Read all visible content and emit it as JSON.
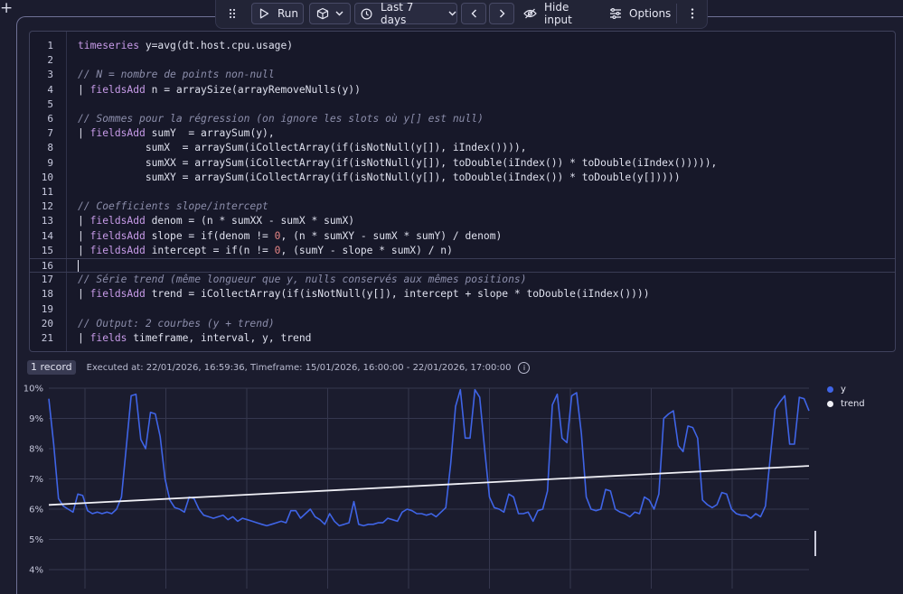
{
  "toolbar": {
    "run_label": "Run",
    "timeframe_label": "Last 7 days",
    "hide_input_label": "Hide input",
    "options_label": "Options"
  },
  "editor": {
    "current_line": 16,
    "lines": [
      [
        {
          "c": "kw",
          "t": "timeseries"
        },
        {
          "t": " y=avg(dt.host.cpu.usage)"
        }
      ],
      [],
      [
        {
          "c": "cm",
          "t": "// N = nombre de points non-null"
        }
      ],
      [
        {
          "t": "| "
        },
        {
          "c": "kw",
          "t": "fieldsAdd"
        },
        {
          "t": " n = arraySize(arrayRemoveNulls(y))"
        }
      ],
      [],
      [
        {
          "c": "cm",
          "t": "// Sommes pour la régression (on ignore les slots où y[] est null)"
        }
      ],
      [
        {
          "t": "| "
        },
        {
          "c": "kw",
          "t": "fieldsAdd"
        },
        {
          "t": " sumY  = arraySum(y),"
        }
      ],
      [
        {
          "t": "           sumX  = arraySum(iCollectArray(if(isNotNull(y[]), iIndex()))),"
        }
      ],
      [
        {
          "t": "           sumXX = arraySum(iCollectArray(if(isNotNull(y[]), toDouble(iIndex()) * toDouble(iIndex())))),"
        }
      ],
      [
        {
          "t": "           sumXY = arraySum(iCollectArray(if(isNotNull(y[]), toDouble(iIndex()) * toDouble(y[]))))"
        }
      ],
      [],
      [
        {
          "c": "cm",
          "t": "// Coefficients slope/intercept"
        }
      ],
      [
        {
          "t": "| "
        },
        {
          "c": "kw",
          "t": "fieldsAdd"
        },
        {
          "t": " denom = (n * sumXX - sumX * sumX)"
        }
      ],
      [
        {
          "t": "| "
        },
        {
          "c": "kw",
          "t": "fieldsAdd"
        },
        {
          "t": " slope = if(denom != "
        },
        {
          "c": "nm",
          "t": "0"
        },
        {
          "t": ", (n * sumXY - sumX * sumY) / denom)"
        }
      ],
      [
        {
          "t": "| "
        },
        {
          "c": "kw",
          "t": "fieldsAdd"
        },
        {
          "t": " intercept = if(n != "
        },
        {
          "c": "nm",
          "t": "0"
        },
        {
          "t": ", (sumY - slope * sumX) / n)"
        }
      ],
      [],
      [
        {
          "c": "cm",
          "t": "// Série trend (même longueur que y, nulls conservés aux mêmes positions)"
        }
      ],
      [
        {
          "t": "| "
        },
        {
          "c": "kw",
          "t": "fieldsAdd"
        },
        {
          "t": " trend = iCollectArray(if(isNotNull(y[]), intercept + slope * toDouble(iIndex())))"
        }
      ],
      [],
      [
        {
          "c": "cm",
          "t": "// Output: 2 courbes (y + trend)"
        }
      ],
      [
        {
          "t": "| "
        },
        {
          "c": "kw",
          "t": "fields"
        },
        {
          "t": " timeframe, interval, y, trend"
        }
      ]
    ]
  },
  "result": {
    "record_count": "1 record",
    "executed_text": "Executed at: 22/01/2026, 16:59:36, Timeframe: 15/01/2026, 16:00:00 - 22/01/2026, 17:00:00",
    "info_glyph": "i"
  },
  "chart_data": {
    "type": "line",
    "y_ticks": [
      "10%",
      "9%",
      "8%",
      "7%",
      "6%",
      "5%",
      "4%"
    ],
    "ylim": [
      4,
      10
    ],
    "grid": true,
    "legend_position": "top-right",
    "series": [
      {
        "name": "y",
        "color": "#3f64e6",
        "values": [
          9.65,
          8.15,
          6.35,
          6.1,
          6.0,
          5.9,
          6.5,
          6.45,
          5.95,
          5.85,
          5.9,
          5.85,
          5.9,
          5.85,
          6.0,
          6.4,
          8.05,
          9.75,
          9.8,
          8.3,
          8.0,
          9.2,
          9.15,
          8.4,
          7.0,
          6.3,
          6.05,
          6.0,
          5.9,
          6.4,
          6.35,
          6.0,
          5.8,
          5.75,
          5.7,
          5.75,
          5.8,
          5.65,
          5.75,
          5.6,
          5.7,
          5.65,
          5.6,
          5.55,
          5.5,
          5.45,
          5.5,
          5.55,
          5.6,
          5.55,
          5.95,
          5.95,
          5.7,
          5.85,
          6.0,
          5.75,
          5.65,
          5.5,
          5.85,
          5.6,
          5.45,
          5.5,
          5.55,
          6.25,
          5.5,
          5.45,
          5.5,
          5.5,
          5.55,
          5.55,
          5.7,
          5.65,
          5.6,
          5.9,
          6.0,
          5.95,
          5.85,
          5.85,
          5.8,
          5.85,
          5.75,
          5.9,
          6.05,
          7.5,
          9.4,
          9.95,
          8.35,
          8.35,
          9.95,
          9.7,
          8.0,
          6.4,
          6.05,
          6.0,
          5.9,
          6.5,
          6.4,
          5.85,
          5.85,
          5.9,
          5.6,
          5.95,
          6.0,
          6.6,
          9.45,
          9.8,
          8.35,
          8.2,
          9.75,
          9.85,
          8.5,
          6.4,
          6.0,
          5.95,
          6.0,
          6.65,
          6.6,
          6.0,
          5.9,
          5.85,
          5.75,
          5.9,
          5.85,
          6.4,
          6.3,
          6.0,
          6.5,
          9.0,
          9.15,
          9.25,
          8.1,
          7.9,
          8.75,
          8.7,
          8.35,
          6.3,
          6.15,
          6.05,
          6.15,
          6.55,
          6.5,
          6.0,
          5.85,
          5.8,
          5.8,
          5.7,
          5.85,
          5.75,
          6.1,
          7.7,
          9.3,
          9.55,
          9.75,
          8.15,
          8.15,
          9.7,
          9.65,
          9.25
        ]
      },
      {
        "name": "trend",
        "color": "#f0f0f6",
        "values": [
          6.14,
          7.43
        ]
      }
    ]
  }
}
